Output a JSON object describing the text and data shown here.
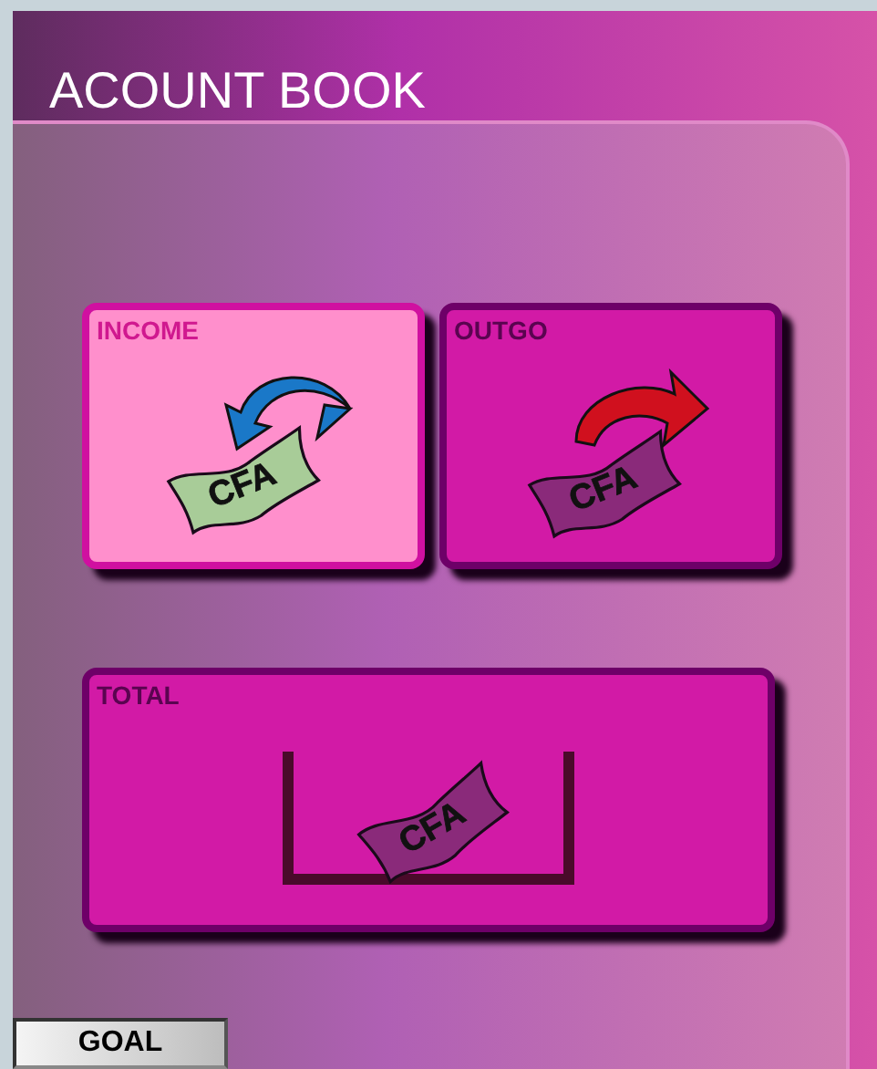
{
  "title": "ACOUNT BOOK",
  "cards": [
    {
      "kind": "income",
      "label": "INCOME",
      "bill": "CFA",
      "selected": true
    },
    {
      "kind": "outgo",
      "label": "OUTGO",
      "bill": "CFA",
      "selected": false
    },
    {
      "kind": "total",
      "label": "TOTAL",
      "bill": "CFA",
      "selected": false
    }
  ],
  "goal_button": "GOAL"
}
